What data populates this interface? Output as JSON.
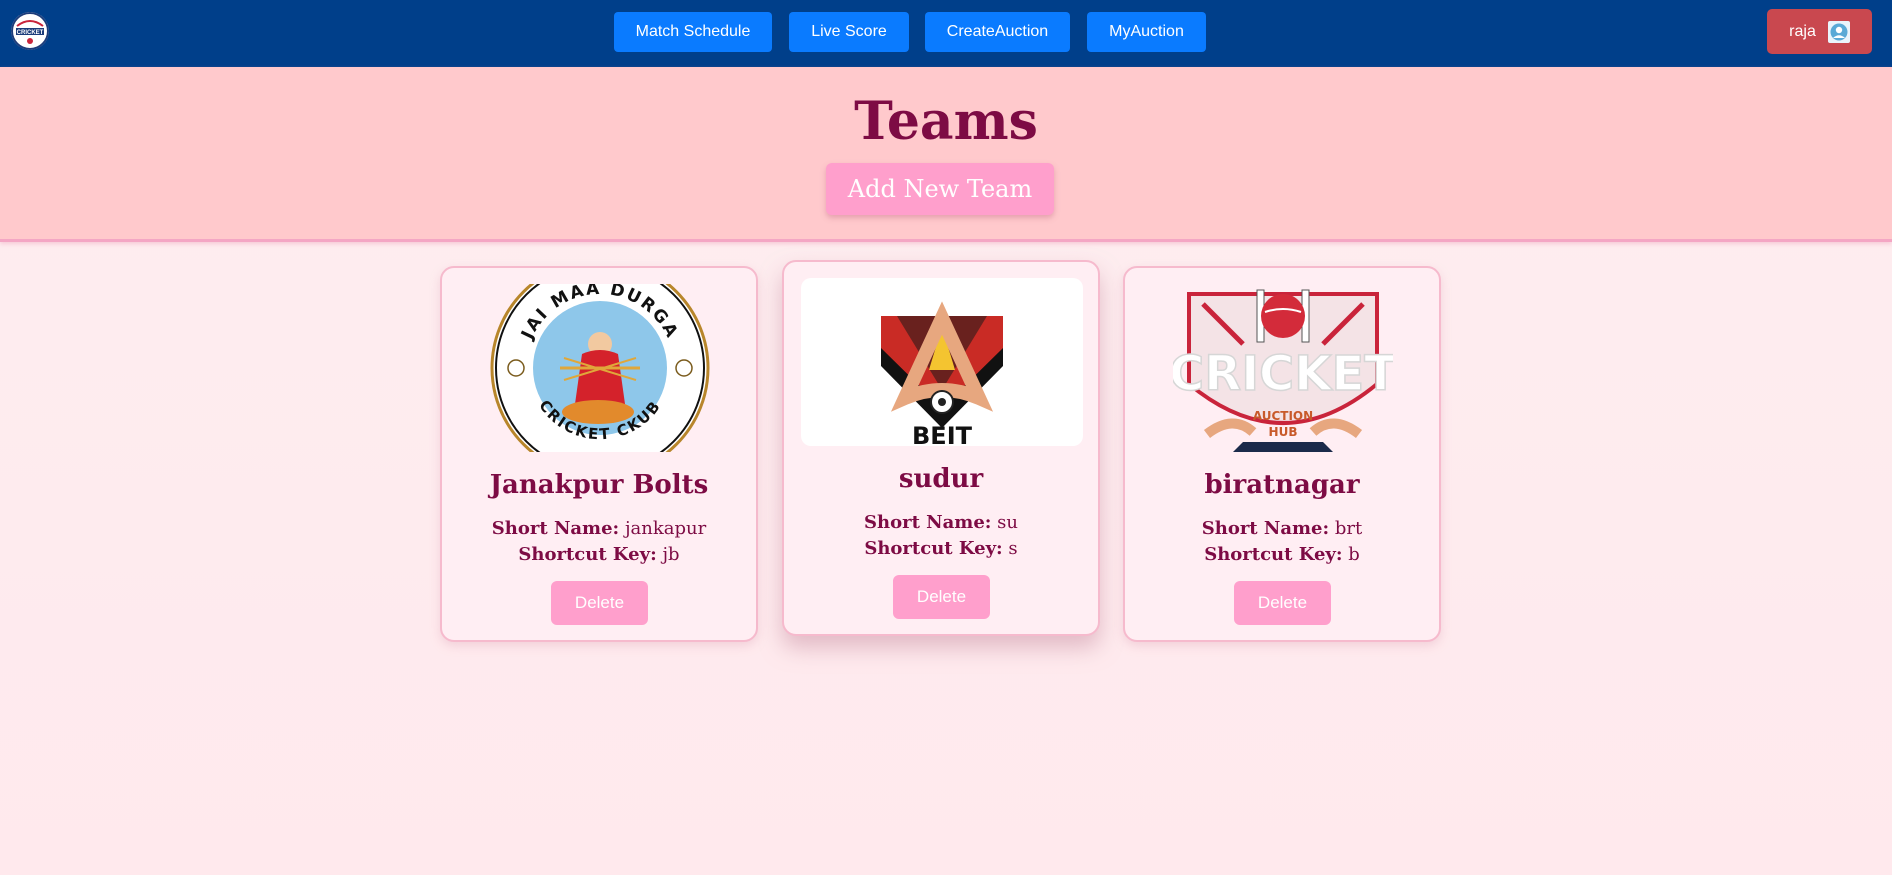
{
  "nav": {
    "logo_icon": "cricket-logo-icon",
    "links": [
      "Match Schedule",
      "Live Score",
      "CreateAuction",
      "MyAuction"
    ],
    "user_name": "raja",
    "user_icon": "user-avatar-icon"
  },
  "header": {
    "title": "Teams",
    "add_button_label": "Add New Team"
  },
  "labels": {
    "short_name": "Short Name:",
    "shortcut_key": "Shortcut Key:",
    "delete": "Delete"
  },
  "teams": [
    {
      "name": "Janakpur Bolts",
      "short_name": "jankapur",
      "shortcut_key": "jb",
      "logo_icon": "jai-maa-durga-cricket-club-logo",
      "logo_text_top": "JAI MAA DURGA",
      "logo_text_bottom": "CRICKET CKUB"
    },
    {
      "name": "sudur",
      "short_name": "su",
      "shortcut_key": "s",
      "logo_icon": "beit-logo",
      "logo_text": "BEIT"
    },
    {
      "name": "biratnagar",
      "short_name": "brt",
      "shortcut_key": "b",
      "logo_icon": "cricket-auction-hub-logo",
      "logo_text_main": "CRICKET",
      "logo_text_sub1": "AUCTION",
      "logo_text_sub2": "HUB"
    }
  ],
  "colors": {
    "navbar": "#003f8a",
    "nav_button": "#0a7bff",
    "user_button": "#c9484f",
    "header_band": "#ffc9cc",
    "accent_pink": "#ff9fcc",
    "title_color": "#7d0b44"
  }
}
